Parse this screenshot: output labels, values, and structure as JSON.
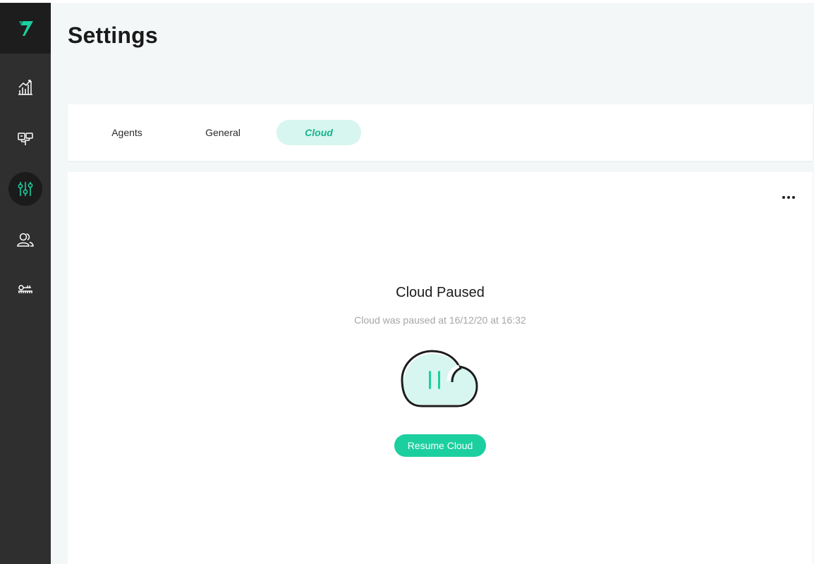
{
  "page": {
    "title": "Settings"
  },
  "sidebar": {
    "logo_icon": "brand-logo-icon",
    "items": [
      {
        "icon": "analytics-chart-icon",
        "active": false
      },
      {
        "icon": "agents-map-icon",
        "active": false
      },
      {
        "icon": "settings-sliders-icon",
        "active": true
      },
      {
        "icon": "users-icon",
        "active": false
      },
      {
        "icon": "keys-icon",
        "active": false
      }
    ]
  },
  "tabs": [
    {
      "label": "Agents",
      "active": false
    },
    {
      "label": "General",
      "active": false
    },
    {
      "label": "Cloud",
      "active": true
    }
  ],
  "cloud_status": {
    "title": "Cloud Paused",
    "subtitle": "Cloud was paused at 16/12/20 at 16:32",
    "icon": "cloud-paused-icon",
    "resume_label": "Resume Cloud",
    "more_icon": "more-options-icon"
  },
  "colors": {
    "accent": "#1ccf9f",
    "accent_light": "#d6f6ef",
    "sidebar_bg": "#2f2f2f",
    "page_bg": "#f4f7f8"
  }
}
